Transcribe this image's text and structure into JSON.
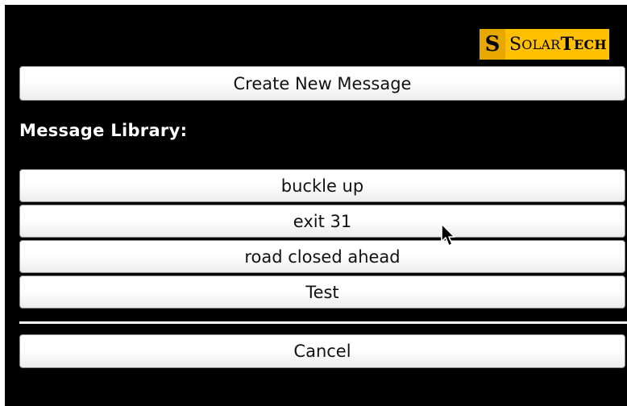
{
  "brand": {
    "logo_mark": "S",
    "logo_text_big1": "S",
    "logo_text_small1": "OLAR",
    "logo_text_big2": "T",
    "logo_text_small2": "ECH",
    "colors": {
      "mark": "#e8a800",
      "text_bg": "#ffc000"
    }
  },
  "actions": {
    "create_label": "Create New Message",
    "cancel_label": "Cancel"
  },
  "library": {
    "heading": "Message Library:",
    "items": [
      {
        "label": "buckle up"
      },
      {
        "label": "exit 31"
      },
      {
        "label": "road closed ahead"
      },
      {
        "label": "Test"
      }
    ]
  },
  "icons": {
    "cursor": "mouse-pointer-icon"
  },
  "colors": {
    "background": "#000000",
    "button_face": "#ffffff",
    "button_border": "#8a8a8a",
    "text_on_dark": "#ffffff"
  }
}
